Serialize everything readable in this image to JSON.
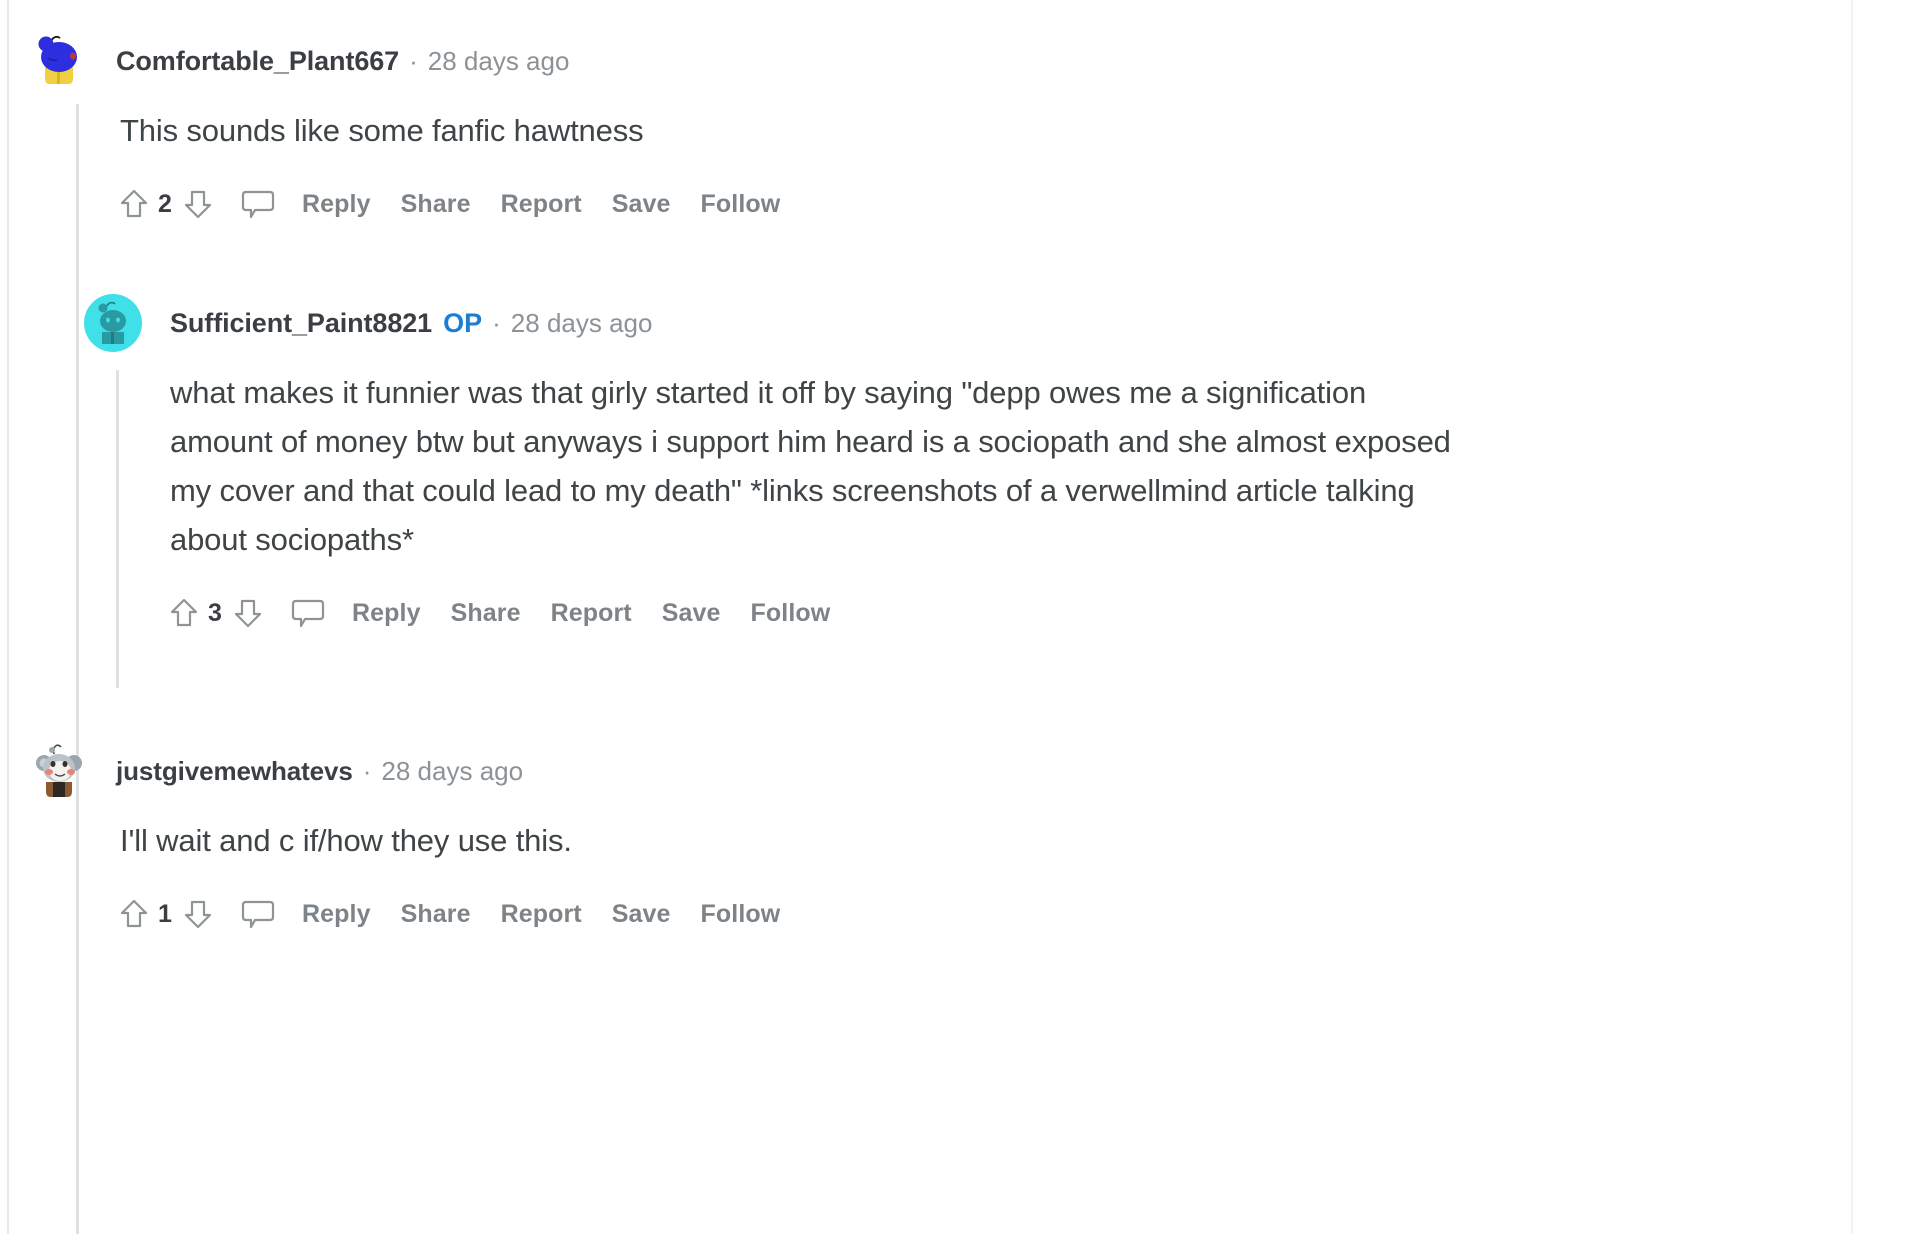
{
  "page": {
    "platform": "reddit-comment-thread"
  },
  "action_labels": {
    "reply": "Reply",
    "share": "Share",
    "report": "Report",
    "save": "Save",
    "follow": "Follow"
  },
  "icons": {
    "upvote": "upvote-arrow-icon",
    "downvote": "downvote-arrow-icon",
    "comment": "comment-bubble-icon"
  },
  "colors": {
    "op_badge": "#1a7fd4",
    "body_text": "#3f4447",
    "username": "#3b3f43",
    "meta_text": "#8c9296",
    "action_text": "#7e8387",
    "thread_line": "#dfe2e4",
    "avatar1_bg": "#2c2ee0",
    "avatar2_bg": "#3fe0e8",
    "avatar3_bg": "#9aa7ad"
  },
  "comments": [
    {
      "id": "comment-1",
      "username": "Comfortable_Plant667",
      "is_op": false,
      "op_label": "",
      "separator": "·",
      "timestamp": "28 days ago",
      "body": "This sounds like some fanfic hawtness",
      "vote_count": "2",
      "avatar_name": "avatar-comfortable-plant667"
    },
    {
      "id": "comment-2",
      "username": "Sufficient_Paint8821",
      "is_op": true,
      "op_label": "OP",
      "separator": "·",
      "timestamp": "28 days ago",
      "body": "what makes it funnier was that girly started it off by saying \"depp owes me a signification amount of money btw but anyways i support him heard is a sociopath and she almost exposed my cover and that could lead to my death\" *links screenshots of a verwellmind article talking about sociopaths*",
      "vote_count": "3",
      "avatar_name": "avatar-sufficient-paint8821"
    },
    {
      "id": "comment-3",
      "username": "justgivemewhatevs",
      "is_op": false,
      "op_label": "",
      "separator": "·",
      "timestamp": "28 days ago",
      "body": "I'll wait and c if/how they use this.",
      "vote_count": "1",
      "avatar_name": "avatar-justgivemewhatevs"
    }
  ]
}
